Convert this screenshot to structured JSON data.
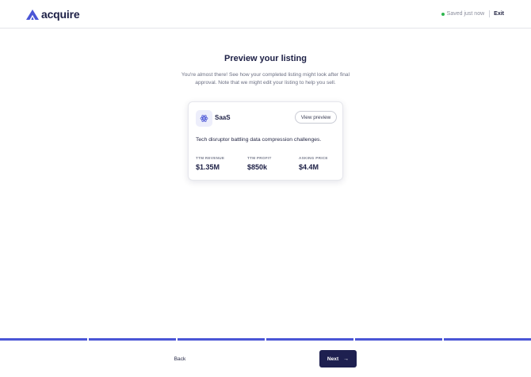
{
  "brand": {
    "name": "acquire",
    "color": "#4a55d6"
  },
  "header": {
    "status": "Saved just now",
    "status_color": "#2fb64f",
    "exit_label": "Exit"
  },
  "page": {
    "title": "Preview your listing",
    "subtitle": "You're almost there! See how your completed listing might look after final approval. Note that we might edit your listing to help you sell."
  },
  "listing": {
    "category": "SaaS",
    "category_icon": "atom-icon",
    "view_preview_label": "View preview",
    "description": "Tech disruptor battling data compression challenges.",
    "metrics": [
      {
        "label": "TTM REVENUE",
        "value": "$1.35M"
      },
      {
        "label": "TTM PROFIT",
        "value": "$850k"
      },
      {
        "label": "ASKING PRICE",
        "value": "$4.4M"
      }
    ]
  },
  "progress": {
    "steps_total": 6,
    "steps_completed": 6
  },
  "footer": {
    "back_label": "Back",
    "next_label": "Next",
    "next_icon": "arrow-right-icon",
    "next_color": "#1e2050"
  }
}
